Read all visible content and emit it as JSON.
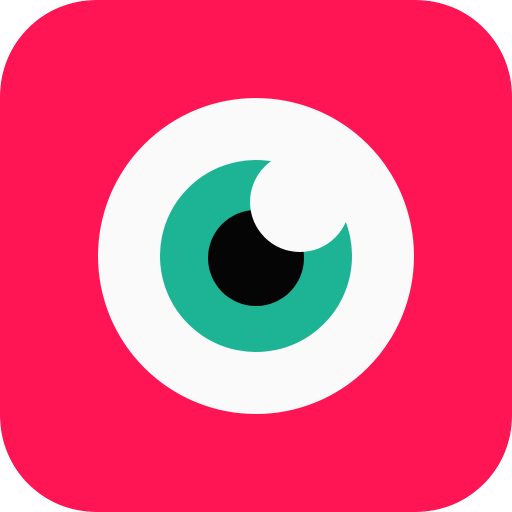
{
  "icon": {
    "name": "eye-icon",
    "colors": {
      "background": "#FF1553",
      "sclera": "#FAFAFA",
      "iris": "#1DB395",
      "pupil": "#050505",
      "highlight": "#FAFAFA"
    }
  }
}
